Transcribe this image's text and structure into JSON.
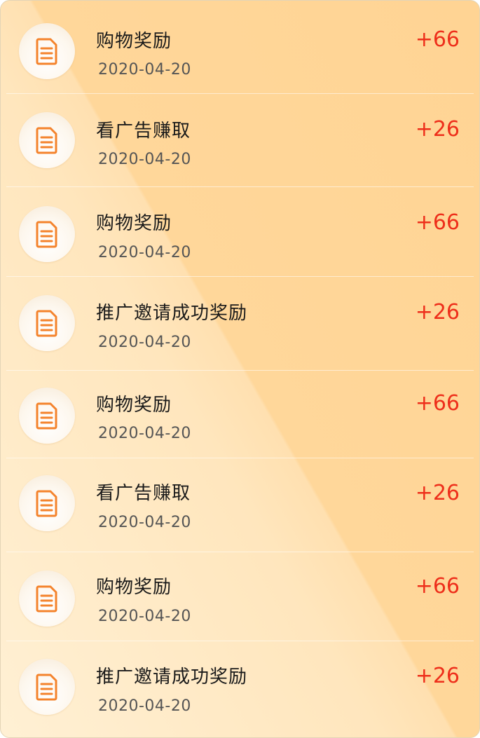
{
  "records": [
    {
      "title": "购物奖励",
      "date": "2020-04-20",
      "amount": "+66",
      "icon": "document-icon"
    },
    {
      "title": "看广告赚取",
      "date": "2020-04-20",
      "amount": "+26",
      "icon": "document-icon"
    },
    {
      "title": "购物奖励",
      "date": "2020-04-20",
      "amount": "+66",
      "icon": "document-icon"
    },
    {
      "title": "推广邀请成功奖励",
      "date": "2020-04-20",
      "amount": "+26",
      "icon": "document-icon"
    },
    {
      "title": "购物奖励",
      "date": "2020-04-20",
      "amount": "+66",
      "icon": "document-icon"
    },
    {
      "title": "看广告赚取",
      "date": "2020-04-20",
      "amount": "+26",
      "icon": "document-icon"
    },
    {
      "title": "购物奖励",
      "date": "2020-04-20",
      "amount": "+66",
      "icon": "document-icon"
    },
    {
      "title": "推广邀请成功奖励",
      "date": "2020-04-20",
      "amount": "+26",
      "icon": "document-icon"
    }
  ],
  "colors": {
    "amount": "#ee2f1b",
    "icon_orange": "#f4832c",
    "panel_gradient_start": "#fff0d4",
    "panel_gradient_end": "#ffd494"
  }
}
